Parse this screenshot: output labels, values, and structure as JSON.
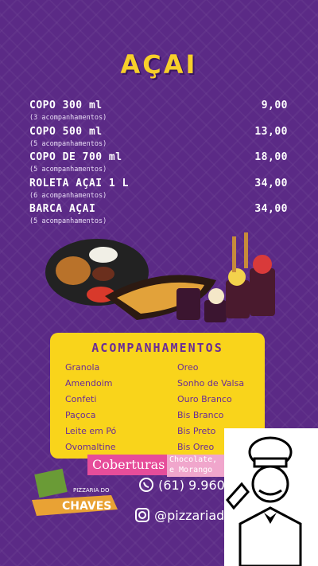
{
  "title": "AÇAI",
  "menu": [
    {
      "name": "COPO 300 ml",
      "price": "9,00",
      "sub": "(3 acompanhamentos)"
    },
    {
      "name": "COPO 500 ml",
      "price": "13,00",
      "sub": "(5 acompanhamentos)"
    },
    {
      "name": "COPO DE 700 ml",
      "price": "18,00",
      "sub": "(5 acompanhamentos)"
    },
    {
      "name": "ROLETA AÇAI 1 L",
      "price": "34,00",
      "sub": "(6 acompanhamentos)"
    },
    {
      "name": "BARCA AÇAI",
      "price": "34,00",
      "sub": "(5 acompanhamentos)"
    }
  ],
  "acompanhamentos": {
    "title": "ACOMPANHAMENTOS",
    "left": [
      "Granola",
      "Amendoim",
      "Confeti",
      "Paçoca",
      "Leite em Pó",
      "Ovomaltine"
    ],
    "right": [
      "Oreo",
      "Sonho de Valsa",
      "Ouro Branco",
      "Bis Branco",
      "Bis Preto",
      "Bis Oreo"
    ]
  },
  "coberturas": {
    "label": "Coberturas",
    "line1": "Chocolate,",
    "line2": "e Morango"
  },
  "contact": {
    "phone": "(61) 9.960",
    "instagram": "@pizzariado_ch"
  },
  "logo": {
    "line1": "PIZZARIA DO",
    "line2": "CHAVES"
  },
  "colors": {
    "bg": "#5b2a86",
    "accent": "#f7cf2a",
    "panel": "#f9d41b",
    "pink": "#e64d9a"
  },
  "icons": {
    "phone": "whatsapp-icon",
    "insta": "instagram-icon"
  }
}
